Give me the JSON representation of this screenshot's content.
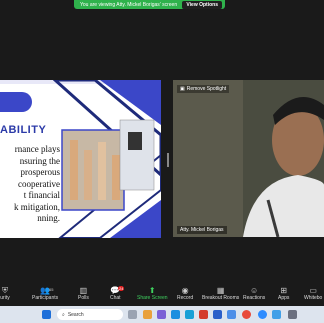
{
  "banner": {
    "text": "You are viewing Atty. Mickel Borigas' screen",
    "view_options": "View Options"
  },
  "slide": {
    "heading": "ABILITY",
    "body_lines": [
      "rnance plays",
      "nsuring the",
      "prosperous",
      "cooperative",
      "t financial",
      "k mitigation,",
      "nning."
    ]
  },
  "video": {
    "remove_spotlight": "Remove Spotlight",
    "name": "Atty. Mickel Borigas"
  },
  "toolbar": {
    "security": "urity",
    "participants": "Participants",
    "participants_count": "65",
    "polls": "Polls",
    "chat": "Chat",
    "chat_badge": "24",
    "share_screen": "Share Screen",
    "record": "Record",
    "breakout": "Breakout Rooms",
    "reactions": "Reactions",
    "apps": "Apps",
    "whiteboards": "Whitebo"
  },
  "taskbar": {
    "search": "Search"
  }
}
